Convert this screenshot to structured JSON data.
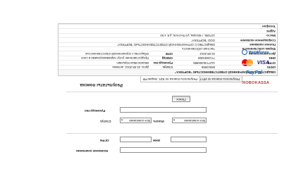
{
  "search_form": {
    "name_label": "Название компании",
    "ogrn_label": "ОГРН",
    "inn_label": "ИНН",
    "status_label": "Статус",
    "search_label": "Искать",
    "status_value": "Все компании",
    "status_value_2": "Все компании",
    "region_label": "Руководство",
    "search_button": "Поиск"
  },
  "results": {
    "heading": "Результаты поиска",
    "tab_rf": "Результаты поиска по ЮЛ, лицам РФ",
    "tab_ip": "Результаты поиска по ИП РФ",
    "company_title": "ОБЩЕСТВО С ОГРАНИЧЕННОЙ ОТВЕТСТВЕННОСТЬЮ \"ВОРТЕКА\"",
    "rows": [
      {
        "k1": "ОКПО",
        "v1": "58043855",
        "k2": "Статус",
        "v2": "Дата: 22.08.2012, активна"
      },
      {
        "k1": "ОГРН",
        "v1": "1127746456985",
        "k2": "Руководство",
        "v2": "Иванов Иван Юрьевич"
      },
      {
        "k1": "ИНН",
        "v1": "7713693458",
        "k2": "ОКВЭД",
        "v2": "Предоставление услуг парикмахерскими и салонами красоты"
      },
      {
        "k1": "Дата регистрации",
        "v1": "22.08.2012",
        "k2": "ОПФ",
        "v2": "Общества с ограниченной ответственностью"
      },
      {
        "k1": "Форма собственности",
        "v1": "Частная собственность",
        "k2": "",
        "v2": ""
      },
      {
        "k1": "Полное название",
        "v1": "ОБЩЕСТВО С ОГРАНИЧЕННОЙ ОТВЕТСТВЕННОСТЬЮ \"ВОРТЕКА\"",
        "k2": "",
        "v2": ""
      },
      {
        "k1": "Сокращенное название",
        "v1": "ООО \"ВОРТЕКА\"",
        "k2": "",
        "v2": ""
      },
      {
        "k1": "Место",
        "v1": "127486, г Москва, ул Пестеля, д 8, к 54",
        "k2": "",
        "v2": ""
      },
      {
        "k1": "Адрес",
        "v1": "",
        "k2": "",
        "v2": ""
      },
      {
        "k1": "Телефон",
        "v1": "",
        "k2": "",
        "v2": ""
      }
    ]
  },
  "payments": {
    "webmoney": "WebMoney",
    "visa": "VISA",
    "mastercard": "MasterCard",
    "paypal": "PayPal",
    "robokassa": "ROBOKASSA"
  },
  "colors": {
    "webmoney": "#1a5aa8",
    "visa": "#1a1f71",
    "paypal": "#1a6fb5",
    "robokassa": "#c0392b",
    "mc_red": "#eb001b",
    "mc_orange": "#f79e1b"
  }
}
